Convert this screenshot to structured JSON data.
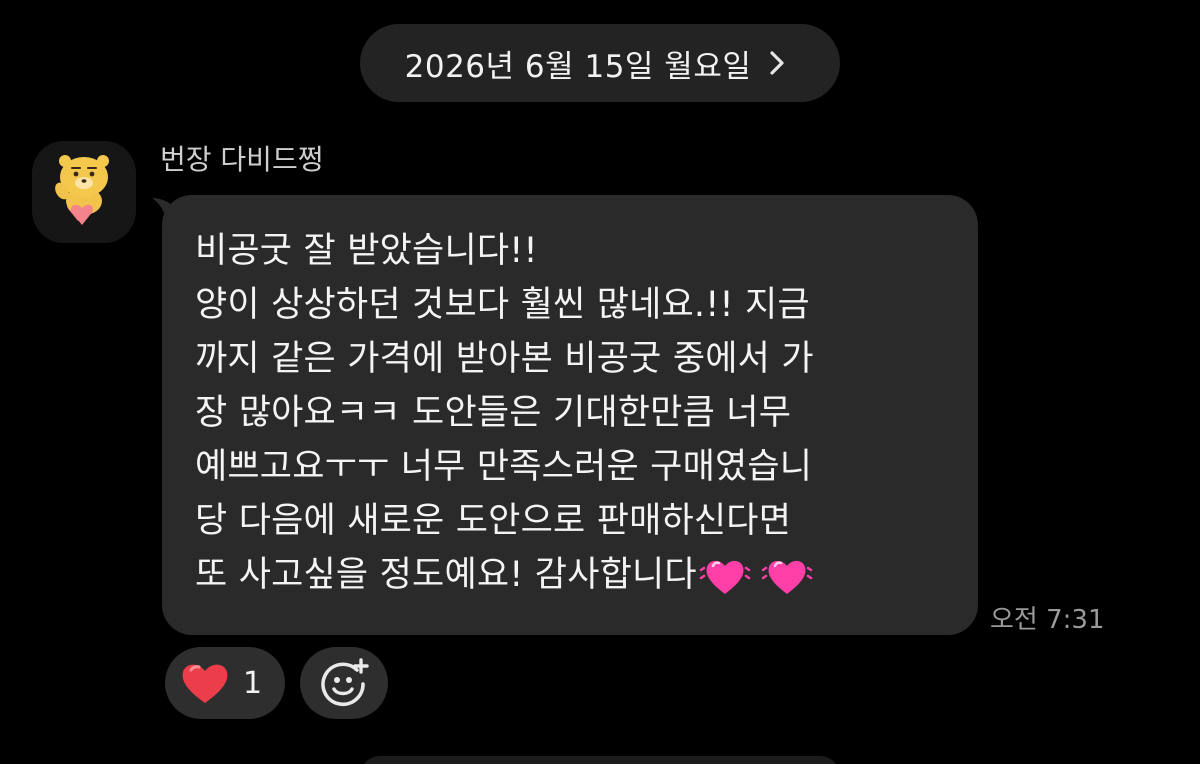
{
  "date_header": {
    "label": "2026년 6월 15일 월요일"
  },
  "message": {
    "sender_name": "번장 다비드쩡",
    "lines": [
      "비공굿 잘 받았습니다!!",
      "양이 상상하던 것보다 훨씬 많네요.!! 지금",
      "까지 같은 가격에 받아본 비공굿 중에서 가",
      "장 많아요ㅋㅋ 도안들은 기대한만큼 너무",
      "예쁘고요ㅜㅜ 너무 만족스러운 구매였습니",
      "당 다음에 새로운 도안으로 판매하신다면",
      "또 사고싶을 정도예요! 감사합니다"
    ],
    "time": "오전 7:31"
  },
  "reactions": {
    "heart_count": "1"
  },
  "colors": {
    "background": "#000000",
    "bubble": "#2a2a2b",
    "pill": "#232323",
    "heart_red": "#ec3d4a",
    "heart_pink": "#ff3fa8"
  },
  "icons": {
    "date_chevron": "chevron-right-icon",
    "reaction": "red-heart-icon",
    "add_reaction": "smiley-plus-icon",
    "emoji_hearts": "vibrating-heart-icon"
  }
}
